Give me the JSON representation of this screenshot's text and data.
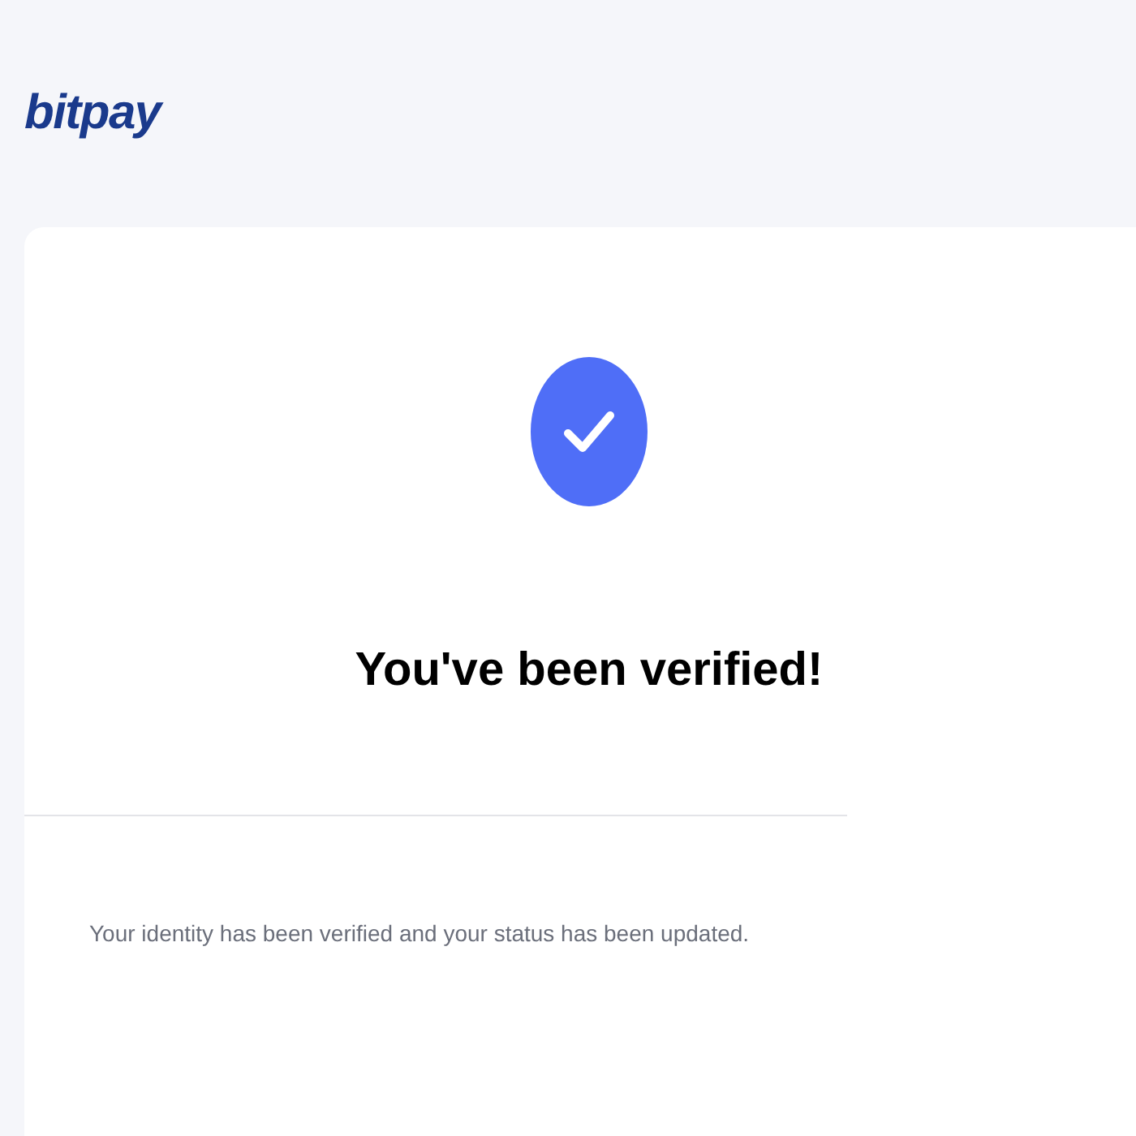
{
  "logo": "bitpay",
  "card": {
    "title": "You've been verified!",
    "message": "Your identity has been verified and your status has been updated."
  }
}
